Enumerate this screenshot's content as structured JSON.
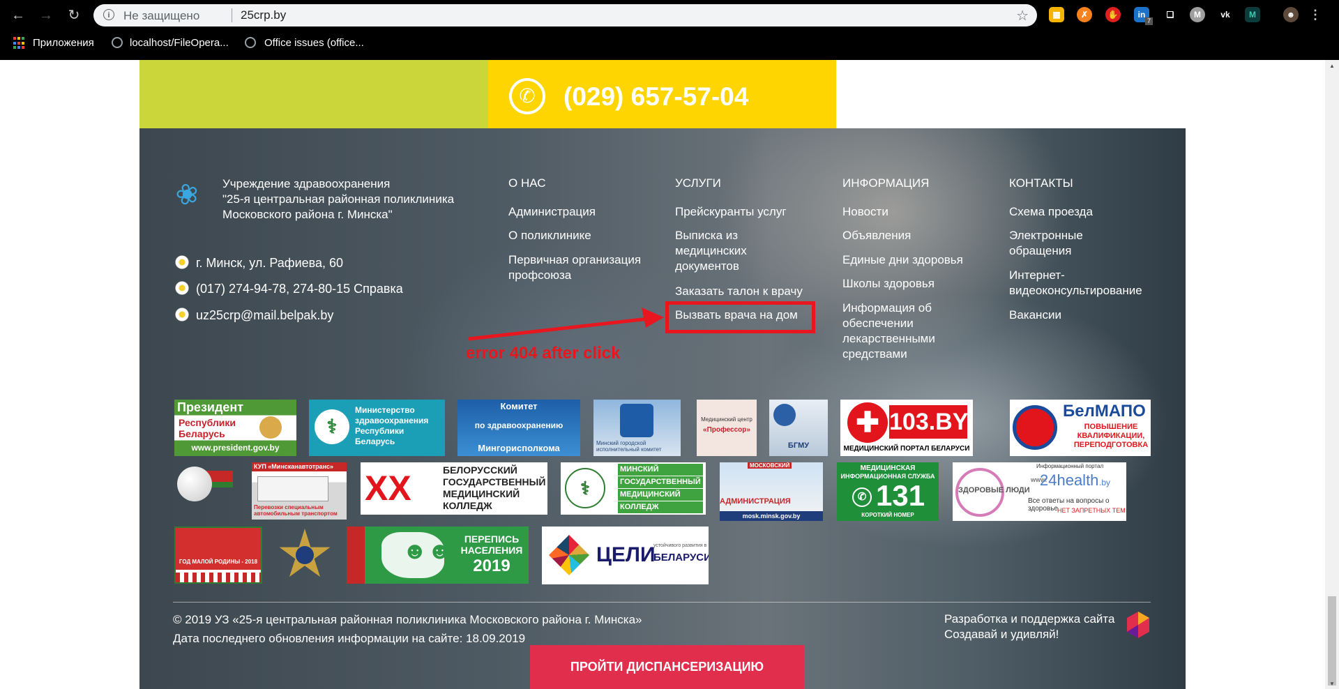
{
  "browser": {
    "security_label": "Не защищено",
    "url": "25crp.by",
    "info_icon": "info-icon",
    "star_icon": "star-icon",
    "nav_icons": [
      "back-arrow-icon",
      "forward-arrow-icon",
      "reload-icon"
    ],
    "extension_badge": "7",
    "bookmarks": [
      {
        "label": "Приложения",
        "icon": "apps-grid-icon"
      },
      {
        "label": "localhost/FileOpera...",
        "icon": "globe-icon"
      },
      {
        "label": "Office issues (office...",
        "icon": "globe-icon"
      }
    ]
  },
  "phone": {
    "number": "(029) 657-57-04",
    "icon": "phone-icon",
    "colors": {
      "green": "#cbd63b",
      "yellow": "#ffd500"
    }
  },
  "org": {
    "name": "Учреждение здравоохранения\n\"25-я центральная районная поликлиника\nМосковского района г. Минска\"",
    "logo_icon": "butterfly-icon",
    "address": "г. Минск, ул. Рафиева, 60",
    "phones": "(017) 274-94-78, 274-80-15 Справка",
    "email": "uz25crp@mail.belpak.by"
  },
  "columns": [
    {
      "title": "О НАС",
      "links": [
        "Администрация",
        "О поликлинике",
        "Первичная организация профсоюза"
      ]
    },
    {
      "title": "УСЛУГИ",
      "links": [
        "Прейскуранты услуг",
        "Выписка из медицинских документов",
        "Заказать талон к врачу",
        "Вызвать врача на дом"
      ]
    },
    {
      "title": "ИНФОРМАЦИЯ",
      "links": [
        "Новости",
        "Объявления",
        "Единые дни здоровья",
        "Школы здоровья",
        "Информация об обеспечении лекарственными средствами"
      ]
    },
    {
      "title": "КОНТАКТЫ",
      "links": [
        "Схема проезда",
        "Электронные обращения",
        "Интернет-видеоконсультирование",
        "Вакансии"
      ]
    }
  ],
  "annotation": {
    "text": "error 404 after click",
    "color": "#e8171f"
  },
  "banners": {
    "president": {
      "line1": "Президент",
      "line2": "Республики",
      "line3": "Беларусь",
      "url": "www.president.gov.by"
    },
    "minzdrav": "Министерство здравоохранения Республики Беларусь",
    "committee": {
      "line1": "Комитет",
      "line2": "по здравоохранению",
      "line3": "Мингорисполкома"
    },
    "minsk_exec": "Минский городской исполнительный комитет",
    "profsoyuz": {
      "line1": "Медицинский центр",
      "line2": "«Профессор»"
    },
    "bgmu": "БГМУ",
    "portal_103": {
      "title": "103.BY",
      "subtitle": "МЕДИЦИНСКИЙ ПОРТАЛ БЕЛАРУСИ"
    },
    "belmapo": {
      "title": "БелМАПО",
      "line1": "ПОВЫШЕНИЕ",
      "line2": "КВАЛИФИКАЦИИ,",
      "line3": "ПЕРЕПОДГОТОВКА"
    },
    "transport": {
      "line1": "КУП «Минсканавтотранс»",
      "line2": "Перевозки специальным",
      "line3": "автомобильным транспортом"
    },
    "med_college": {
      "line1": "БЕЛОРУССКИЙ",
      "line2": "ГОСУДАРСТВЕННЫЙ",
      "line3": "МЕДИЦИНСКИЙ",
      "line4": "КОЛЛЕДЖ"
    },
    "minsk_college": {
      "line1": "МИНСКИЙ",
      "line2": "ГОСУДАРСТВЕННЫЙ",
      "line3": "МЕДИЦИНСКИЙ",
      "line4": "КОЛЛЕДЖ"
    },
    "moscow_admin": {
      "line1": "МОСКОВСКИЙ",
      "line2": "АДМИНИСТРАЦИЯ",
      "url": "mosk.minsk.gov.by"
    },
    "service_131": {
      "line1": "МЕДИЦИНСКАЯ",
      "line2": "ИНФОРМАЦИОННАЯ СЛУЖБА",
      "number": "131",
      "footer": "КОРОТКИЙ НОМЕР"
    },
    "health24": {
      "top": "Информационный портал",
      "left": "ЗДОРОВЫЕ ЛЮДИ",
      "brand": "24health",
      "brand_suffix": ".by",
      "tagline": "Все ответы на вопросы о здоровье",
      "footer": "НЕТ ЗАПРЕТНЫХ ТЕМ",
      "www": "www."
    },
    "small_homeland": "ГОД МАЛОЙ РОДИНЫ - 2018",
    "census": {
      "line1": "ПЕРЕПИСЬ",
      "line2": "НАСЕЛЕНИЯ",
      "year": "2019"
    },
    "goals": {
      "main": "ЦЕЛИ",
      "small": "устойчивого развития в",
      "country": "БЕЛАРУСИ"
    }
  },
  "footer": {
    "copyright": "© 2019 УЗ «25-я центральная районная поликлиника Московского района г. Минска»",
    "updated": "Дата последнего обновления информации на сайте: 18.09.2019",
    "dev_line1": "Разработка и поддержка сайта",
    "dev_line2": "Создавай и удивляй!",
    "cta": "ПРОЙТИ ДИСПАНСЕРИЗАЦИЮ",
    "cta_color": "#e02e4c"
  }
}
